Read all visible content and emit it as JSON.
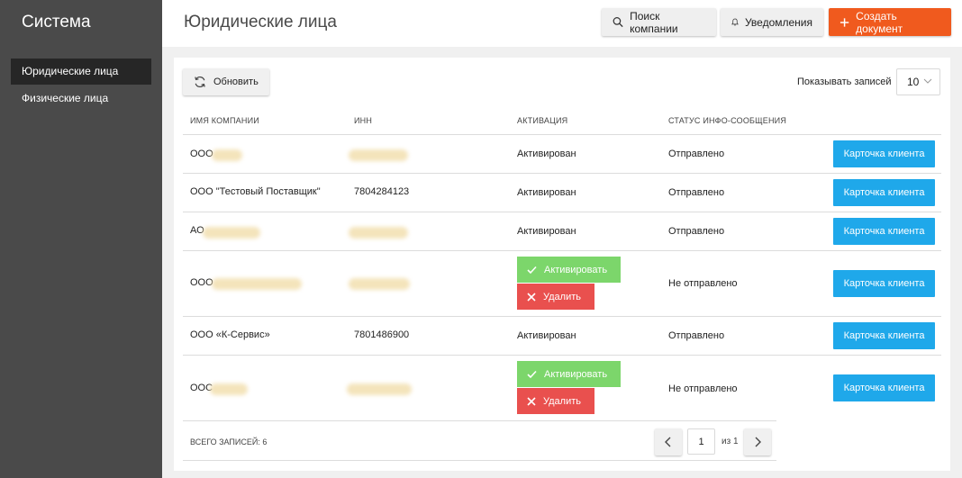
{
  "sidebar": {
    "brand": "Система",
    "items": [
      {
        "label": "Юридические лица",
        "active": true
      },
      {
        "label": "Физические лица",
        "active": false
      }
    ]
  },
  "header": {
    "title": "Юридические лица",
    "search_label": "Поиск компании",
    "notifications_label": "Уведомления",
    "create_label": "Создать документ"
  },
  "toolbar": {
    "refresh_label": "Обновить",
    "show_label": "Показывать записей",
    "page_size": "10"
  },
  "table": {
    "columns": [
      "ИМЯ КОМПАНИИ",
      "ИНН",
      "АКТИВАЦИЯ",
      "СТАТУС ИНФО-СООБЩЕНИЯ"
    ],
    "rows": [
      {
        "name": "ООО",
        "inn": "",
        "activation": "Активирован",
        "status": "Отправлено",
        "card": "Карточка клиента"
      },
      {
        "name": "ООО \"Тестовый Поставщик\"",
        "inn": "7804284123",
        "activation": "Активирован",
        "status": "Отправлено",
        "card": "Карточка клиента"
      },
      {
        "name": "АО",
        "inn": "",
        "activation": "Активирован",
        "status": "Отправлено",
        "card": "Карточка клиента"
      },
      {
        "name": "ООО",
        "inn": "",
        "activate_label": "Активировать",
        "delete_label": "Удалить",
        "status": "Не отправлено",
        "card": "Карточка клиента"
      },
      {
        "name": "ООО «К-Сервис»",
        "inn": "7801486900",
        "activation": "Активирован",
        "status": "Отправлено",
        "card": "Карточка клиента"
      },
      {
        "name": "ООС",
        "inn": "",
        "activate_label": "Активировать",
        "delete_label": "Удалить",
        "status": "Не отправлено",
        "card": "Карточка клиента"
      }
    ]
  },
  "footer": {
    "total": "ВСЕГО ЗАПИСЕЙ: 6",
    "page": "1",
    "of_pages": "из 1"
  },
  "colors": {
    "sidebar": "#4a4a4a",
    "create_button": "#f05a1e",
    "card_button": "#1fa8ea",
    "activate_button": "#7cd66b",
    "delete_button": "#e9504e"
  },
  "icons": [
    "search-icon",
    "bell-icon",
    "plus-icon",
    "refresh-icon",
    "chevron-down-icon",
    "check-icon",
    "x-icon",
    "chevron-left-icon",
    "chevron-right-icon"
  ]
}
